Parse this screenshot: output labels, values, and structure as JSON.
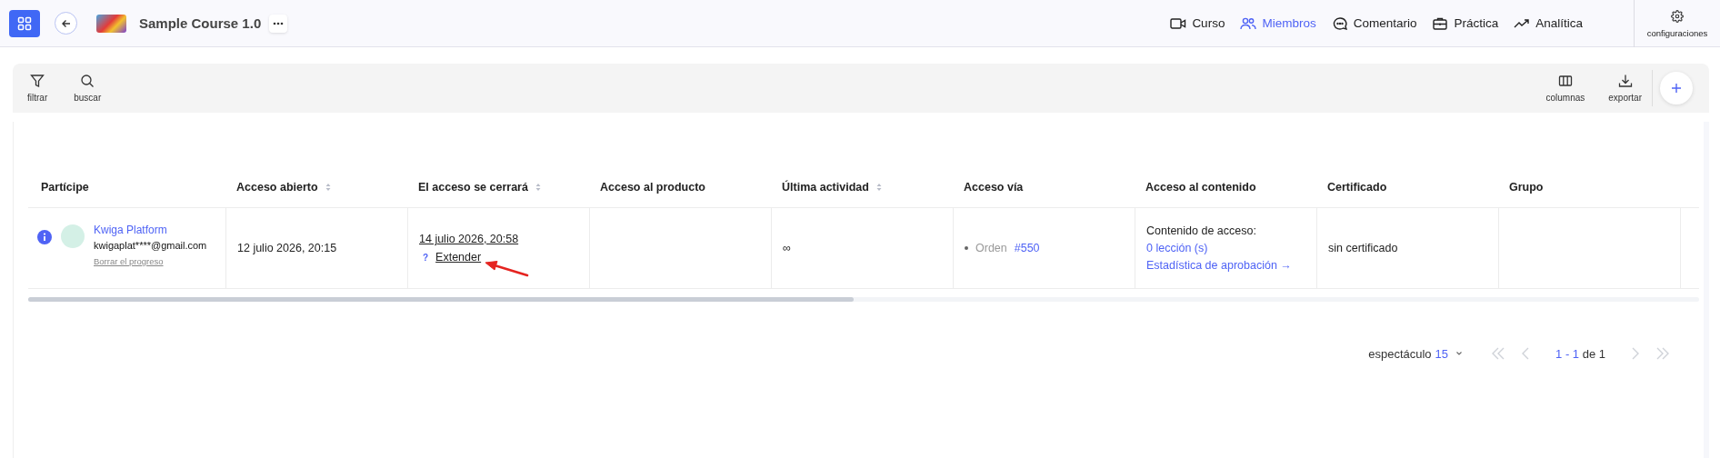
{
  "app_bar": {
    "course_title": "Sample Course 1.0",
    "nav": [
      {
        "label": "Curso",
        "kind": "video",
        "selected": false
      },
      {
        "label": "Miembros",
        "kind": "people",
        "selected": true
      },
      {
        "label": "Comentario",
        "kind": "chat",
        "selected": false
      },
      {
        "label": "Práctica",
        "kind": "briefcase",
        "selected": false
      },
      {
        "label": "Analítica",
        "kind": "trend",
        "selected": false
      }
    ],
    "settings_label": "configuraciones"
  },
  "toolbar": {
    "left": [
      {
        "label": "filtrar",
        "kind": "filter"
      },
      {
        "label": "buscar",
        "kind": "search"
      }
    ],
    "right": [
      {
        "label": "columnas",
        "kind": "columns"
      },
      {
        "label": "exportar",
        "kind": "export"
      }
    ]
  },
  "table": {
    "columns": [
      {
        "label": "Partícipe",
        "sortable": false
      },
      {
        "label": "Acceso abierto",
        "sortable": true
      },
      {
        "label": "El acceso se cerrará",
        "sortable": true
      },
      {
        "label": "Acceso al producto",
        "sortable": false
      },
      {
        "label": "Última actividad",
        "sortable": true
      },
      {
        "label": "Acceso vía",
        "sortable": false
      },
      {
        "label": "Acceso al contenido",
        "sortable": false
      },
      {
        "label": "Certificado",
        "sortable": false
      },
      {
        "label": "Grupo",
        "sortable": false
      }
    ],
    "rows": [
      {
        "participant": {
          "name": "Kwiga Platform",
          "email": "kwigaplat****@gmail.com",
          "reset_link": "Borrar el progreso"
        },
        "access_opened": "12 julio 2026, 20:15",
        "access_closes": {
          "date": "14 julio 2026, 20:58",
          "hint": "?",
          "extend": "Extender",
          "pointer_arrow": true
        },
        "last_activity": "∞",
        "access_via": {
          "label": "Orden",
          "order": "#550"
        },
        "content_access": {
          "heading": "Contenido de acceso:",
          "lessons": "0 lección (s)",
          "stats_link": "Estadística de aprobación →"
        },
        "certificate": "sin certificado"
      }
    ]
  },
  "pagination": {
    "show_label": "espectáculo",
    "page_size": "15",
    "range": "1 - 1",
    "of_total": "de 1",
    "arrows": [
      {
        "kind": "first",
        "disabled": true
      },
      {
        "kind": "prev",
        "disabled": true
      },
      {
        "kind": "next",
        "disabled": true
      },
      {
        "kind": "last",
        "disabled": true
      }
    ]
  }
}
